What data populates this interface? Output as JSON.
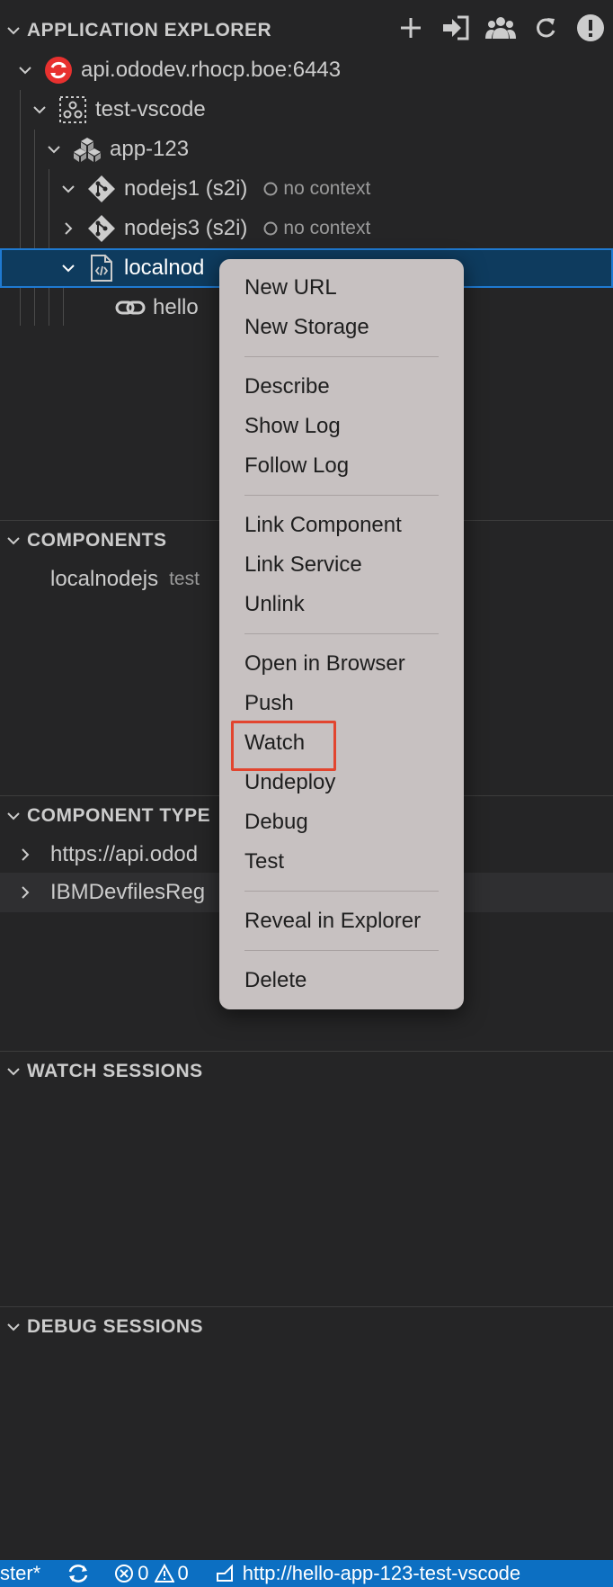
{
  "explorer": {
    "title": "APPLICATION EXPLORER",
    "actions": [
      "plus-icon",
      "login-icon",
      "users-icon",
      "refresh-icon",
      "info-icon"
    ]
  },
  "tree": {
    "cluster": "api.ododev.rhocp.boe:6443",
    "project": "test-vscode",
    "app": "app-123",
    "nodejs1": {
      "label": "nodejs1 (s2i)",
      "desc": "no context"
    },
    "nodejs3": {
      "label": "nodejs3 (s2i)",
      "desc": "no context"
    },
    "local": "localnod",
    "url": "hello"
  },
  "components": {
    "title": "COMPONENTS",
    "item_label": "localnodejs",
    "item_desc": "test"
  },
  "component_types": {
    "title": "COMPONENT TYPE",
    "items": [
      "https://api.odod",
      "IBMDevfilesReg"
    ]
  },
  "watch": {
    "title": "WATCH SESSIONS"
  },
  "debug": {
    "title": "DEBUG SESSIONS"
  },
  "menu": {
    "new_url": "New URL",
    "new_storage": "New Storage",
    "describe": "Describe",
    "show_log": "Show Log",
    "follow_log": "Follow Log",
    "link_component": "Link Component",
    "link_service": "Link Service",
    "unlink": "Unlink",
    "open_browser": "Open in Browser",
    "push": "Push",
    "watch": "Watch",
    "undeploy": "Undeploy",
    "debug": "Debug",
    "test": "Test",
    "reveal": "Reveal in Explorer",
    "delete": "Delete"
  },
  "status": {
    "branch": "ster*",
    "errors": "0",
    "warnings": "0",
    "url": "http://hello-app-123-test-vscode"
  },
  "colors": {
    "background": "#252526",
    "selection": "#0e3b5e",
    "accent": "#1f7ad1",
    "statusbar": "#0c6fc2",
    "menu": "#c7c1c1",
    "highlight": "#e2452f",
    "openshift_red": "#e8312f"
  }
}
